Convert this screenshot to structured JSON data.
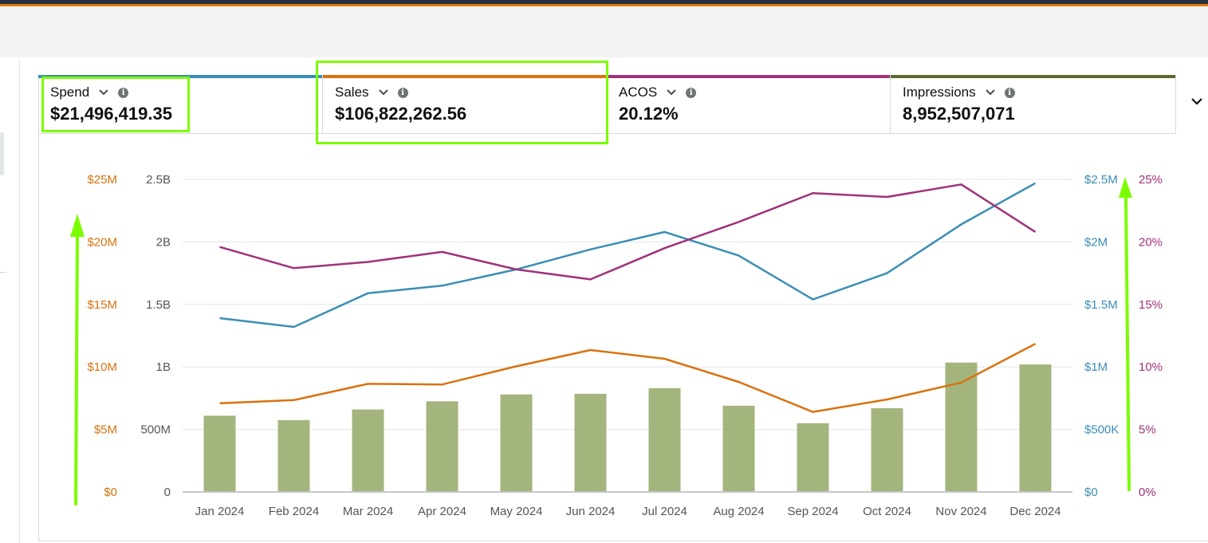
{
  "metrics": [
    {
      "label": "Spend",
      "value": "$21,496,419.35",
      "color": "#3a8eb5"
    },
    {
      "label": "Sales",
      "value": "$106,822,262.56",
      "color": "#d9720f"
    },
    {
      "label": "ACOS",
      "value": "20.12%",
      "color": "#a03278"
    },
    {
      "label": "Impressions",
      "value": "8,952,507,071",
      "color": "#5c6b2e"
    }
  ],
  "icons": {
    "dropdown": "chevron-down-icon",
    "info": "info-icon",
    "expand": "chevron-down-icon"
  },
  "chart_data": {
    "type": "bar",
    "categories": [
      "Jan 2024",
      "Feb 2024",
      "Mar 2024",
      "Apr 2024",
      "May 2024",
      "Jun 2024",
      "Jul 2024",
      "Aug 2024",
      "Sep 2024",
      "Oct 2024",
      "Nov 2024",
      "Dec 2024"
    ],
    "series": [
      {
        "name": "Impressions",
        "type": "bar",
        "axis": "impressions",
        "color": "#a3b57d",
        "values": [
          610000000,
          575000000,
          660000000,
          725000000,
          780000000,
          785000000,
          830000000,
          690000000,
          550000000,
          670000000,
          1035000000,
          1020000000
        ]
      },
      {
        "name": "Sales",
        "type": "line",
        "axis": "sales",
        "color": "#d9720f",
        "values": [
          7100000,
          7350000,
          8650000,
          8600000,
          10050000,
          11350000,
          10650000,
          8800000,
          6400000,
          7400000,
          8750000,
          11850000
        ]
      },
      {
        "name": "Spend",
        "type": "line",
        "axis": "spend",
        "color": "#3a8eb5",
        "values": [
          1390000,
          1320000,
          1590000,
          1650000,
          1780000,
          1940000,
          2080000,
          1890000,
          1540000,
          1750000,
          2140000,
          2470000
        ]
      },
      {
        "name": "ACOS",
        "type": "line",
        "axis": "acos",
        "color": "#a03278",
        "values": [
          19.6,
          17.9,
          18.4,
          19.2,
          17.8,
          17.0,
          19.5,
          21.6,
          23.9,
          23.6,
          24.6,
          20.8
        ]
      }
    ],
    "axes": {
      "sales": {
        "side": "left",
        "ticks": [
          "$0",
          "$5M",
          "$10M",
          "$15M",
          "$20M",
          "$25M"
        ],
        "range": [
          0,
          25000000
        ],
        "color": "#d9720f"
      },
      "impressions": {
        "side": "left",
        "ticks": [
          "0",
          "500M",
          "1B",
          "1.5B",
          "2B",
          "2.5B"
        ],
        "range": [
          0,
          2500000000
        ],
        "color": "#555555"
      },
      "spend": {
        "side": "right",
        "ticks": [
          "$0",
          "$500K",
          "$1M",
          "$1.5M",
          "$2M",
          "$2.5M"
        ],
        "range": [
          0,
          2500000
        ],
        "color": "#3a8eb5"
      },
      "acos": {
        "side": "right",
        "ticks": [
          "0%",
          "5%",
          "10%",
          "15%",
          "20%",
          "25%"
        ],
        "range": [
          0,
          25
        ],
        "color": "#a03278"
      }
    },
    "grid": true,
    "gridline_color": "#e3e6e6"
  },
  "annotations": {
    "highlight_color": "#7cfc00",
    "arrow_color": "#7cfc00"
  }
}
